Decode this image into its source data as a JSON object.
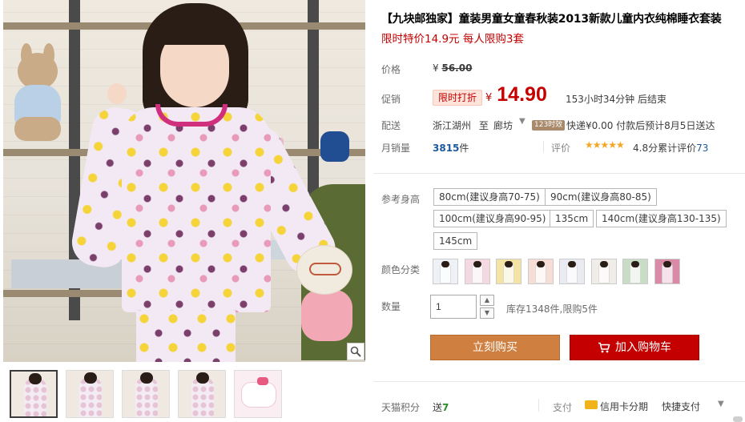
{
  "product": {
    "title": "【九块邮独家】童装男童女童春秋装2013新款儿童内衣纯棉睡衣套装",
    "subtitle": "限时特价14.9元 每人限购3套"
  },
  "price": {
    "label": "价格",
    "currency": "¥",
    "original": "56.00"
  },
  "promo": {
    "label": "促销",
    "badge": "限时打折",
    "currency": "¥",
    "price": "14.90",
    "countdown": "153小时34分钟 后结束"
  },
  "shipping": {
    "label": "配送",
    "from": "浙江湖州",
    "to_word": "至",
    "to": "廊坊",
    "tag": "123时效",
    "info": "快递¥0.00 付款后预计8月5日送达"
  },
  "sales": {
    "label": "月销量",
    "count": "3815",
    "unit": "件",
    "review_label": "评价",
    "stars": "★★★★★",
    "score": "4.8分",
    "cumulative_label": "累计评价",
    "review_count": "73"
  },
  "size": {
    "label": "参考身高",
    "options": [
      "80cm(建议身高70-75)",
      "90cm(建议身高80-85)",
      "100cm(建议身高90-95)",
      "135cm",
      "140cm(建议身高130-135)",
      "145cm"
    ]
  },
  "color": {
    "label": "颜色分类",
    "swatch_colors": [
      "#eef1f6",
      "#f4d9e3",
      "#f3e3a4",
      "#f6ddd5",
      "#eaeaf3",
      "#f0ece7",
      "#c9dcc6",
      "#d98aa6"
    ]
  },
  "quantity": {
    "label": "数量",
    "value": "1",
    "up_icon": "▲",
    "down_icon": "▼",
    "stock": "库存1348件,限购5件"
  },
  "actions": {
    "buy_now": "立刻购买",
    "add_to_cart": "加入购物车"
  },
  "footer": {
    "points_label": "天猫积分",
    "points_prefix": "送",
    "points_value": "7",
    "pay_label": "支付",
    "credit": "信用卡分期",
    "quick": "快捷支付",
    "caret": "▼"
  },
  "ui_colors": {
    "accent_red": "#c40000",
    "buy_orange": "#cf7f3f",
    "link_blue": "#1c5a9c"
  }
}
